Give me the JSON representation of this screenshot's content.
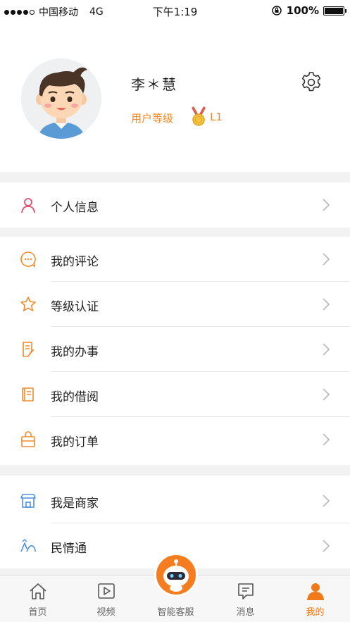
{
  "status_bar": {
    "carrier": "中国移动",
    "network": "4G",
    "time": "下午1:19",
    "battery_pct_text": "100%",
    "battery_level": 1.0
  },
  "profile": {
    "name": "李＊慧",
    "level_label": "用户等级",
    "level_value": "L1",
    "settings_icon": "gear-icon",
    "avatar_icon": "cartoon-boy-avatar"
  },
  "groups": [
    {
      "items": [
        {
          "label": "个人信息",
          "icon": "person-icon",
          "color": "#e0506e"
        }
      ]
    },
    {
      "items": [
        {
          "label": "我的评论",
          "icon": "comment-icon",
          "color": "#f08a2a"
        },
        {
          "label": "等级认证",
          "icon": "star-icon",
          "color": "#f08a2a"
        },
        {
          "label": "我的办事",
          "icon": "document-edit-icon",
          "color": "#f08a2a"
        },
        {
          "label": "我的借阅",
          "icon": "book-icon",
          "color": "#f08a2a"
        },
        {
          "label": "我的订单",
          "icon": "bag-icon",
          "color": "#f08a2a"
        }
      ]
    },
    {
      "items": [
        {
          "label": "我是商家",
          "icon": "shop-icon",
          "color": "#4a90e2"
        },
        {
          "label": "民情通",
          "icon": "people-icon",
          "color": "#4a90e2"
        }
      ]
    }
  ],
  "tab_bar": {
    "tabs": [
      {
        "label": "首页",
        "icon": "home-icon",
        "active": false
      },
      {
        "label": "视频",
        "icon": "video-icon",
        "active": false
      },
      {
        "label": "智能客服",
        "icon": "robot-icon",
        "active": false
      },
      {
        "label": "消息",
        "icon": "message-icon",
        "active": false
      },
      {
        "label": "我的",
        "icon": "user-icon",
        "active": true
      }
    ]
  },
  "colors": {
    "accent": "#f07a1a",
    "level_text": "#f08a2a",
    "chevron": "#bbbbbb"
  }
}
